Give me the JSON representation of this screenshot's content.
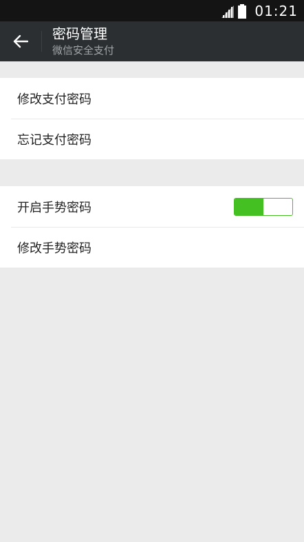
{
  "status_bar": {
    "time": "01:21",
    "signal_icon": "signal-icon",
    "battery_icon": "battery-icon"
  },
  "header": {
    "back_icon": "arrow-left-icon",
    "title": "密码管理",
    "subtitle": "微信安全支付"
  },
  "groups": [
    {
      "items": [
        {
          "label": "修改支付密码"
        },
        {
          "label": "忘记支付密码"
        }
      ]
    },
    {
      "items": [
        {
          "label": "开启手势密码",
          "toggle": true,
          "toggle_state": "on"
        },
        {
          "label": "修改手势密码"
        }
      ]
    }
  ],
  "colors": {
    "accent": "#44c022",
    "status_bar": "#141414",
    "action_bar": "#2b2f32",
    "background": "#ebebeb"
  }
}
